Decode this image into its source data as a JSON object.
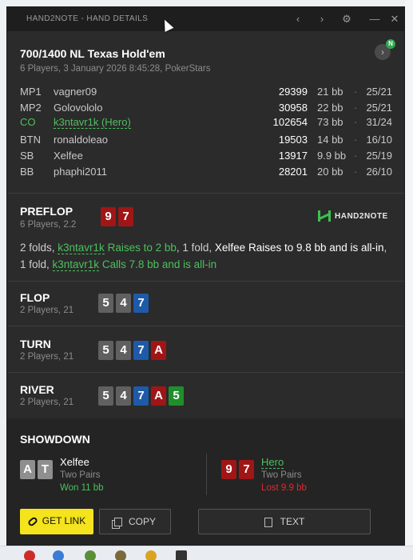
{
  "window": {
    "title": "HAND2NOTE - HAND DETAILS",
    "controls": {
      "prev": "‹",
      "next": "›",
      "settings": "⚙",
      "minimize": "—",
      "close": "✕"
    }
  },
  "hand": {
    "title": "700/1400 NL Texas Hold'em",
    "subtitle": "6 Players, 3 January 2026 8:45:28, PokerStars",
    "next_button": "›",
    "new_badge": "N"
  },
  "players": [
    {
      "pos": "MP1",
      "name": "vagner09",
      "stack": "29399",
      "bb": "21 bb",
      "stat": "25/21",
      "hero": false
    },
    {
      "pos": "MP2",
      "name": "Golovololo",
      "stack": "30958",
      "bb": "22 bb",
      "stat": "25/21",
      "hero": false
    },
    {
      "pos": "CO",
      "name": "k3ntavr1k (Hero)",
      "stack": "102654",
      "bb": "73 bb",
      "stat": "31/24",
      "hero": true
    },
    {
      "pos": "BTN",
      "name": "ronaldoleao",
      "stack": "19503",
      "bb": "14 bb",
      "stat": "16/10",
      "hero": false
    },
    {
      "pos": "SB",
      "name": "Xelfee",
      "stack": "13917",
      "bb": "9.9 bb",
      "stat": "25/19",
      "hero": false
    },
    {
      "pos": "BB",
      "name": "phaphi2011",
      "stack": "28201",
      "bb": "20 bb",
      "stat": "26/10",
      "hero": false
    }
  ],
  "dot": "·",
  "preflop": {
    "name": "PREFLOP",
    "sub": "6 Players, 2.2",
    "cards": [
      "9",
      "7"
    ],
    "logo": "HAND2NOTE",
    "actions": {
      "a1": "2 folds, ",
      "a2": "k3ntavr1k",
      "a3": " Raises to 2 bb",
      "a4": ", 1 fold, ",
      "a5": "Xelfee",
      "a6": " Raises to 9.8 bb and is all-in",
      "a7": ", 1 fold, ",
      "a8": "k3ntavr1k",
      "a9": " Calls 7.8 bb and is all-in"
    }
  },
  "flop": {
    "name": "FLOP",
    "sub": "2 Players, 21",
    "cards": [
      "5",
      "4",
      "7"
    ]
  },
  "turn": {
    "name": "TURN",
    "sub": "2 Players, 21",
    "cards": [
      "5",
      "4",
      "7",
      "A"
    ]
  },
  "river": {
    "name": "RIVER",
    "sub": "2 Players, 21",
    "cards": [
      "5",
      "4",
      "7",
      "A",
      "5"
    ]
  },
  "showdown": {
    "title": "SHOWDOWN",
    "left": {
      "cards": [
        "A",
        "T"
      ],
      "name": "Xelfee",
      "hand": "Two Pairs",
      "result": "Won 11 bb"
    },
    "right": {
      "cards": [
        "9",
        "7"
      ],
      "name": "Hero",
      "hand": "Two Pairs",
      "result": "Lost 9.9 bb"
    }
  },
  "buttons": {
    "get_link": "GET LINK",
    "copy": "COPY",
    "text": "TEXT"
  },
  "colors": {
    "hero": "#4cc05d",
    "won": "#4cc05d",
    "lost": "#e02a2a",
    "accent": "#f4e31d"
  }
}
